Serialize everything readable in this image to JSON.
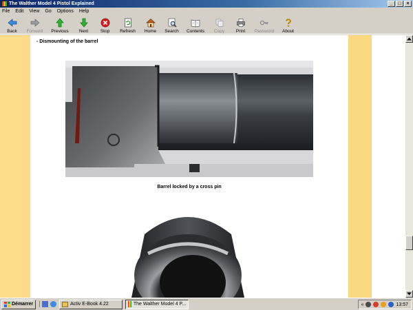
{
  "window": {
    "title": "The Walther Model 4 Pistol Explained"
  },
  "menu": [
    "File",
    "Edit",
    "View",
    "Go",
    "Options",
    "Help"
  ],
  "toolbar": {
    "back": "Back",
    "forward": "Forward",
    "previous": "Previous",
    "next": "Next",
    "stop": "Stop",
    "refresh": "Refresh",
    "home": "Home",
    "search": "Search",
    "contents": "Contents",
    "copy": "Copy",
    "print": "Print",
    "password": "Password",
    "about": "About"
  },
  "content": {
    "heading": "- Dismounting of the barrel",
    "caption": "Barrel locked by a cross pin"
  },
  "taskbar": {
    "start": "Démarrer",
    "task1": "Activ E-Book 4.22",
    "task2": "The Walther Model 4 P...",
    "clock": "13:57"
  },
  "colors": {
    "page_band": "#fcdc88",
    "titlebar": "#0a246a"
  }
}
